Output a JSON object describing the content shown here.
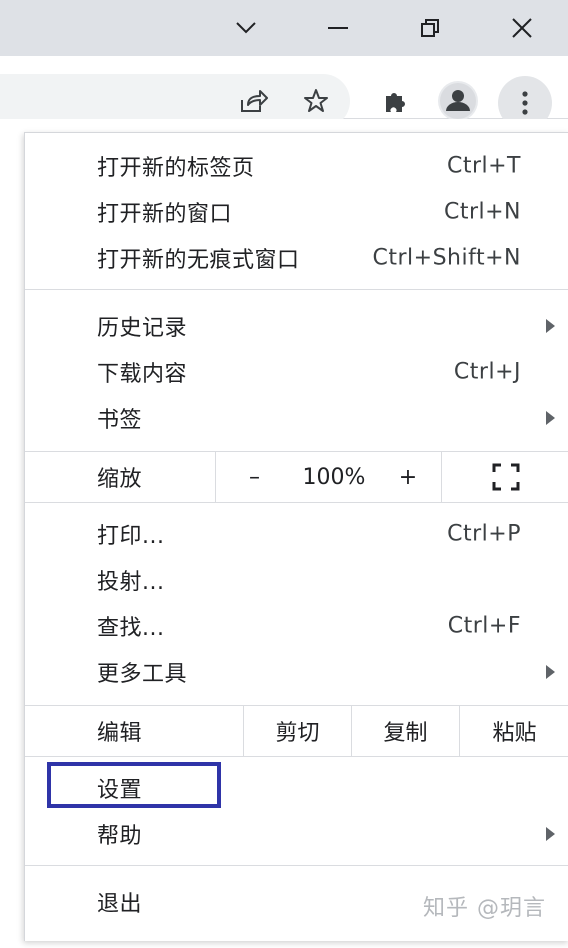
{
  "titlebar": {
    "minimize_glyph": "—",
    "tabsearch_glyph": "˅"
  },
  "menu": {
    "group1": [
      {
        "label": "打开新的标签页",
        "shortcut": "Ctrl+T"
      },
      {
        "label": "打开新的窗口",
        "shortcut": "Ctrl+N"
      },
      {
        "label": "打开新的无痕式窗口",
        "shortcut": "Ctrl+Shift+N"
      }
    ],
    "group2": [
      {
        "label": "历史记录",
        "shortcut": ""
      },
      {
        "label": "下载内容",
        "shortcut": "Ctrl+J"
      },
      {
        "label": "书签",
        "shortcut": ""
      }
    ],
    "zoom": {
      "label": "缩放",
      "minus": "–",
      "value": "100%",
      "plus": "+"
    },
    "group3": [
      {
        "label": "打印...",
        "shortcut": "Ctrl+P"
      },
      {
        "label": "投射...",
        "shortcut": ""
      },
      {
        "label": "查找...",
        "shortcut": "Ctrl+F"
      },
      {
        "label": "更多工具",
        "shortcut": ""
      }
    ],
    "edit": {
      "label": "编辑",
      "cut": "剪切",
      "copy": "复制",
      "paste": "粘贴"
    },
    "group4": [
      {
        "label": "设置"
      },
      {
        "label": "帮助"
      }
    ],
    "exit": {
      "label": "退出"
    }
  },
  "watermark": "知乎 @玥言",
  "colors": {
    "highlight_border": "#2f34a8",
    "titlebar_bg": "#dee1e6"
  }
}
